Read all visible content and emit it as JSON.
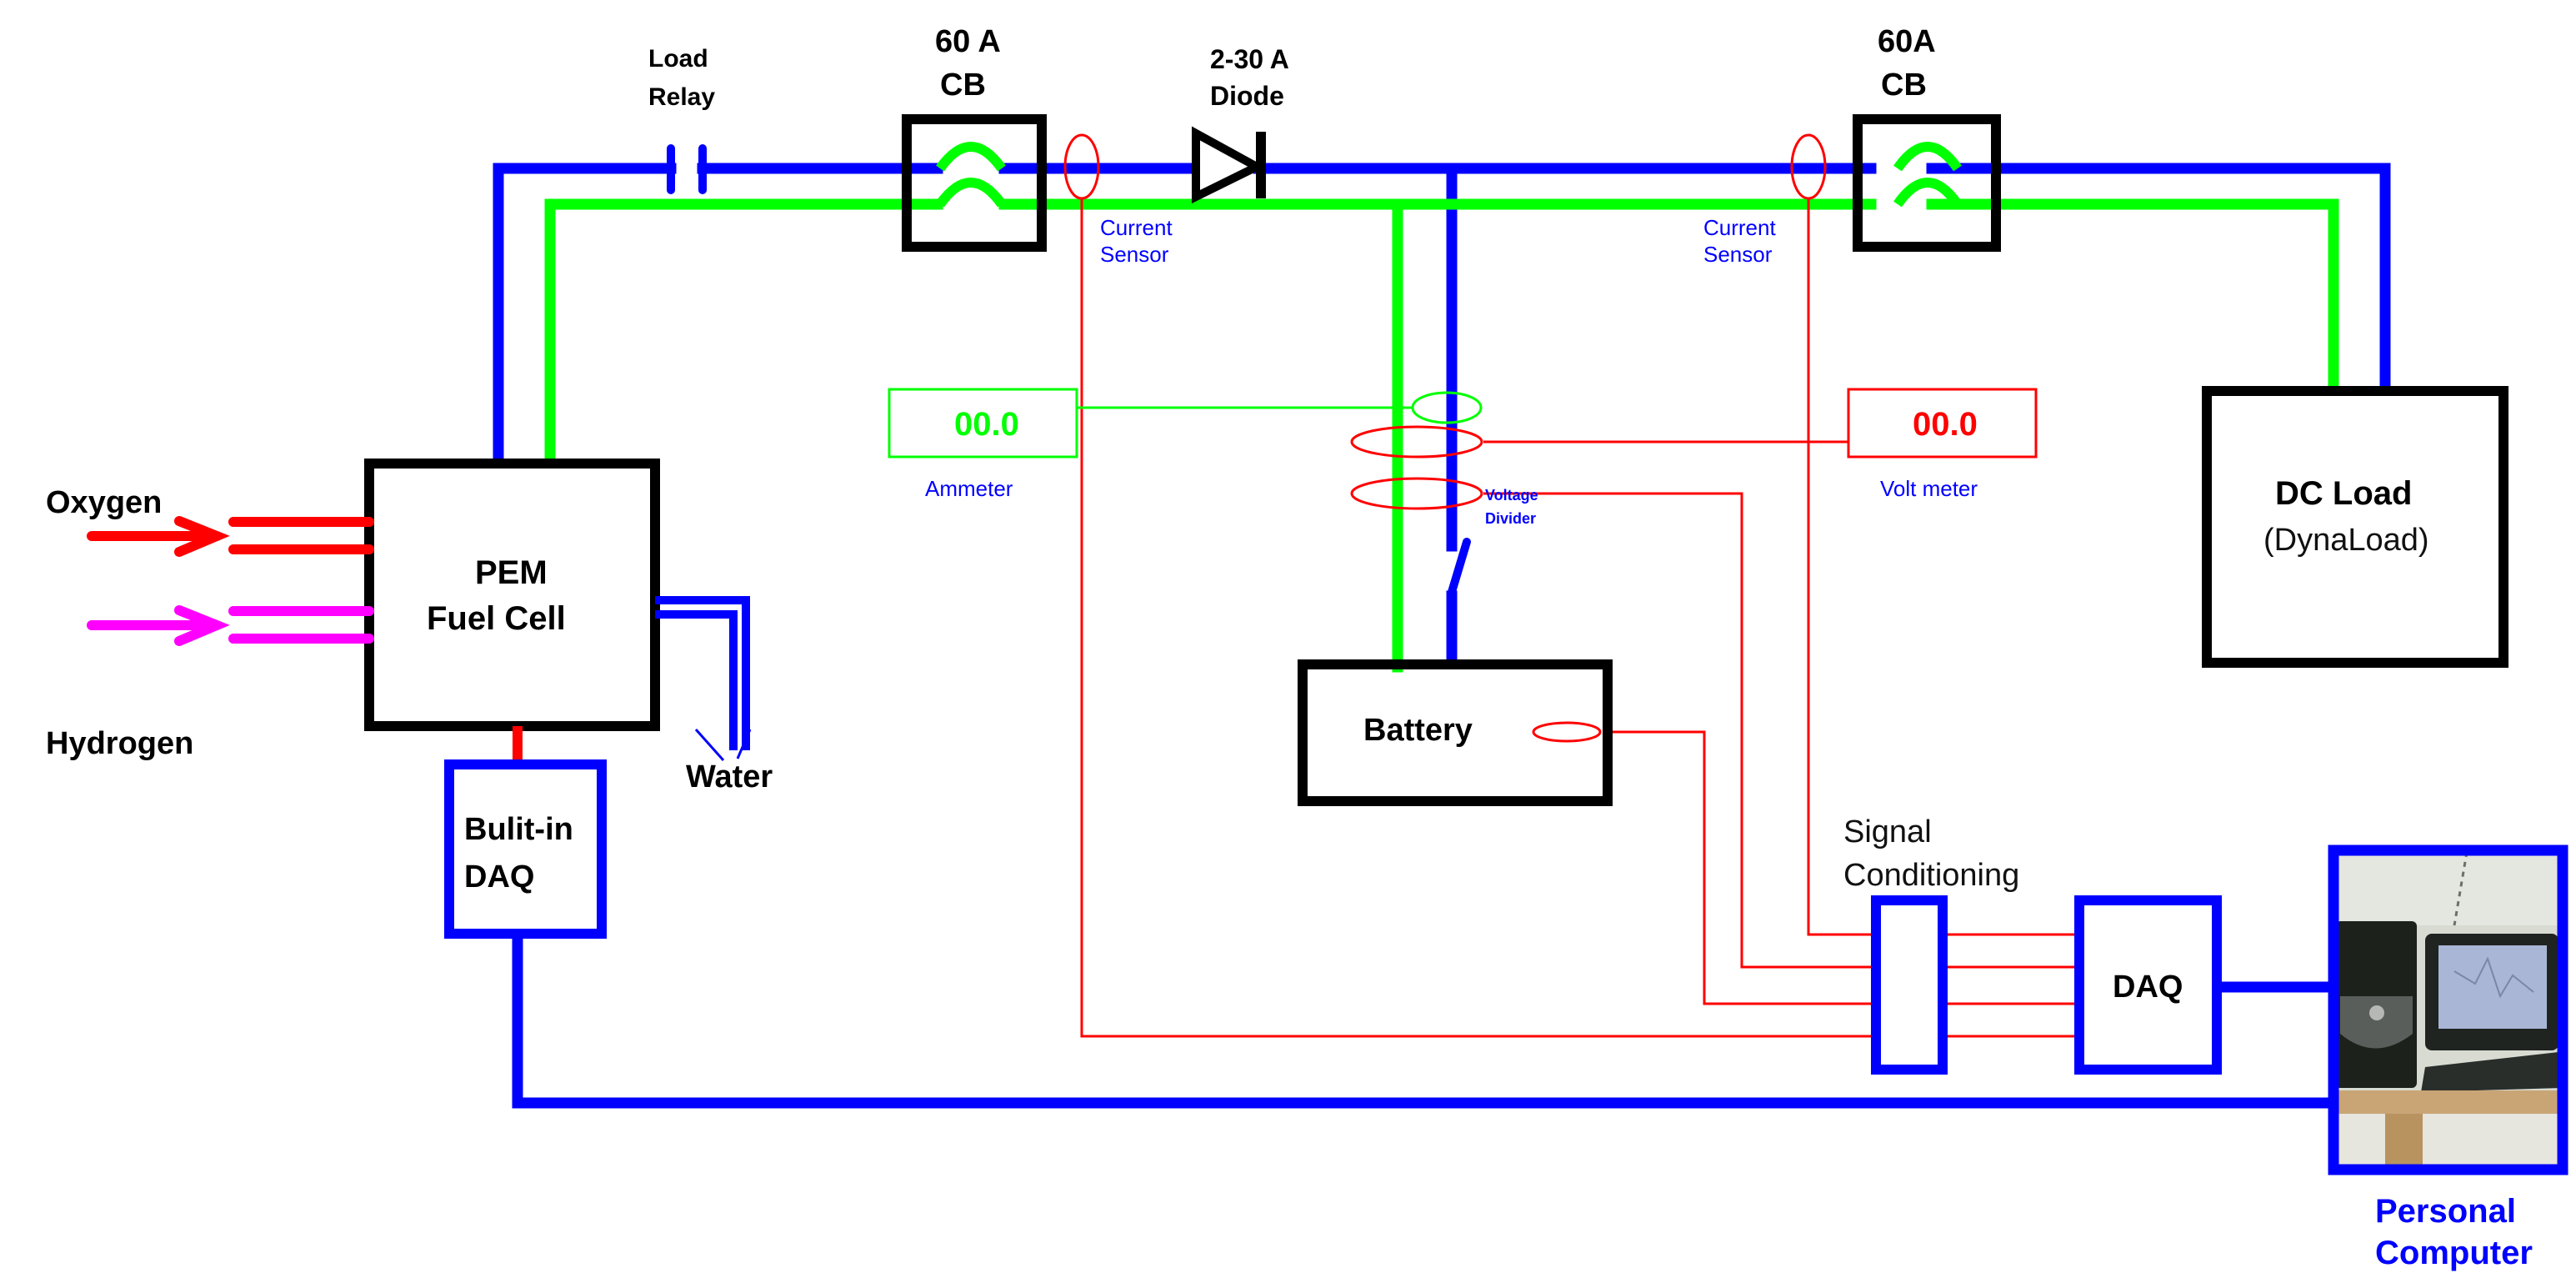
{
  "diagram": {
    "title": "PEM Fuel Cell test system wiring diagram",
    "colors": {
      "positive_wire": "#0000ff",
      "negative_wire": "#00ff00",
      "signal_wire": "#ff0000",
      "oxygen": "#ff0000",
      "hydrogen": "#ff00ff",
      "water": "#0000ff",
      "component_border": "#000000",
      "daq_border": "#0000ff"
    },
    "inputs": {
      "oxygen": "Oxygen",
      "hydrogen": "Hydrogen",
      "water": "Water"
    },
    "components": {
      "fuel_cell": {
        "line1": "PEM",
        "line2": "Fuel Cell"
      },
      "builtin_daq": {
        "line1": "Bulit-in",
        "line2": "DAQ"
      },
      "load_relay": {
        "line1": "Load",
        "line2": "Relay"
      },
      "cb1": {
        "line1": "60 A",
        "line2": "CB"
      },
      "diode": {
        "line1": "2-30 A",
        "line2": "Diode"
      },
      "cb2": {
        "line1": "60A",
        "line2": "CB"
      },
      "current_sensor_1": {
        "line1": "Current",
        "line2": "Sensor"
      },
      "current_sensor_2": {
        "line1": "Current",
        "line2": "Sensor"
      },
      "ammeter": {
        "value": "00.0",
        "label": "Ammeter"
      },
      "voltmeter": {
        "value": "00.0",
        "label": "Volt meter"
      },
      "voltage_divider": {
        "line1": "Voltage",
        "line2": "Divider"
      },
      "battery": {
        "label": "Battery"
      },
      "dc_load": {
        "line1": "DC Load",
        "line2": "(DynaLoad)"
      },
      "signal_conditioning": {
        "line1": "Signal",
        "line2": "Conditioning"
      },
      "daq": {
        "label": "DAQ"
      },
      "personal_computer": {
        "line1": "Personal",
        "line2": "Computer"
      }
    }
  }
}
